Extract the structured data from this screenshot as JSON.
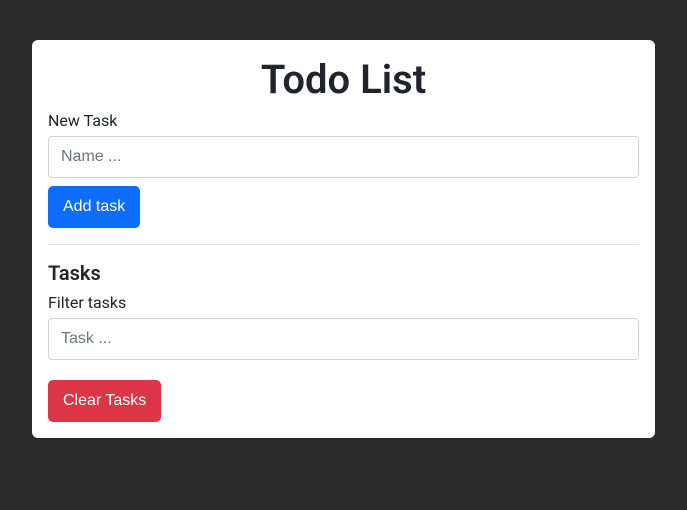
{
  "page_title": "Todo List",
  "new_task": {
    "label": "New Task",
    "placeholder": "Name ...",
    "value": "",
    "button_label": "Add task"
  },
  "tasks": {
    "heading": "Tasks",
    "filter_label": "Filter tasks",
    "filter_placeholder": "Task ...",
    "filter_value": "",
    "clear_button_label": "Clear Tasks"
  }
}
